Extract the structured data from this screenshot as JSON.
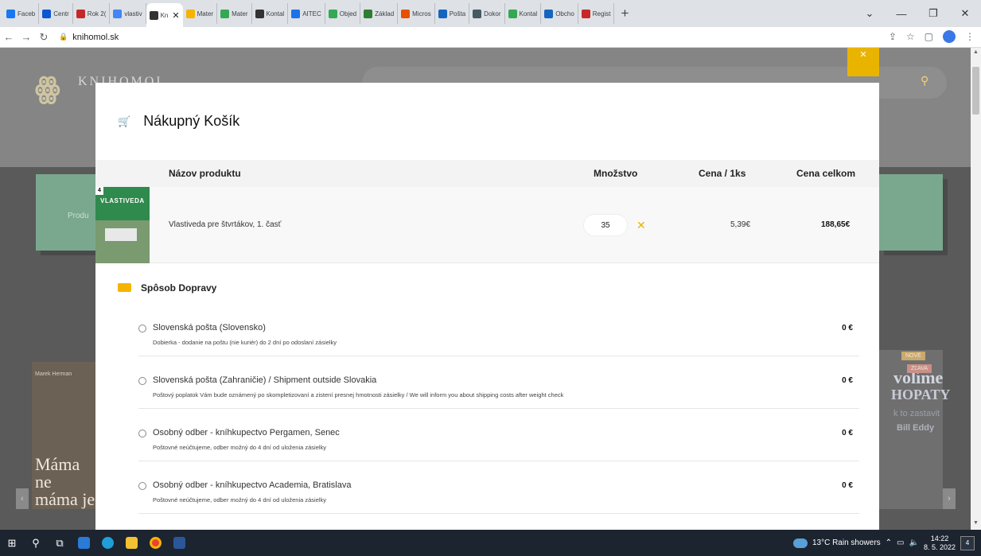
{
  "browser": {
    "tabs": [
      {
        "label": "Faceb",
        "color": "#1877f2"
      },
      {
        "label": "Centr",
        "color": "#0b57d0"
      },
      {
        "label": "Rok 2(",
        "color": "#c62828"
      },
      {
        "label": "vlastiv",
        "color": "#4285f4"
      },
      {
        "label": "Kn",
        "color": "#333333",
        "active": true
      },
      {
        "label": "Mater",
        "color": "#f4b400"
      },
      {
        "label": "Mater",
        "color": "#34a853"
      },
      {
        "label": "Kontal",
        "color": "#333333"
      },
      {
        "label": "AITEC",
        "color": "#1a73e8"
      },
      {
        "label": "Objed",
        "color": "#34a853"
      },
      {
        "label": "Základ",
        "color": "#2e7d32"
      },
      {
        "label": "Micros",
        "color": "#e65100"
      },
      {
        "label": "Pošta",
        "color": "#1565c0"
      },
      {
        "label": "Dokor",
        "color": "#455a64"
      },
      {
        "label": "Kontal",
        "color": "#34a853"
      },
      {
        "label": "Obcho",
        "color": "#1565c0"
      },
      {
        "label": "Regist",
        "color": "#c62828"
      }
    ],
    "url": "knihomol.sk"
  },
  "site": {
    "brand_name": "KNIHOMOL",
    "badge_new": "NOVÉ",
    "badge_sale": "ZĽAVA",
    "left_card": "Produ",
    "left_book": {
      "author": "Marek Herman",
      "title": "Máma ne máma je"
    },
    "right_book": {
      "line1": "volíme",
      "line2": "HOPATY",
      "line3": "k to zastavit",
      "line4": "Bill Eddy"
    }
  },
  "cart": {
    "title": "Nákupný Košík",
    "columns": {
      "name": "Názov produktu",
      "qty": "Množstvo",
      "unit": "Cena / 1ks",
      "total": "Cena celkom"
    },
    "product": {
      "cover_grade": "4",
      "cover_title": "VLASTIVEDA",
      "name": "Vlastiveda pre štvrtákov, 1. časť",
      "quantity": "35",
      "unit_price": "5,39€",
      "total_price": "188,65€"
    }
  },
  "shipping": {
    "title": "Spôsob Dopravy",
    "options": [
      {
        "name": "Slovenská pošta (Slovensko)",
        "desc": "Dobierka - dodanie na poštu (nie kuriér) do 2 dní po odoslaní zásielky",
        "price": "0 €"
      },
      {
        "name": "Slovenská pošta (Zahraničie) / Shipment outside Slovakia",
        "desc": "Poštový poplatok Vám bude oznámený po skompletizovaní a zistení presnej hmotnosti zásielky / We will inform you about shipping costs after weight check",
        "price": "0 €"
      },
      {
        "name": "Osobný odber - kníhkupectvo Pergamen, Senec",
        "desc": "Poštovné neúčtujeme, odber možný do 4 dní od uloženia zásielky",
        "price": "0 €"
      },
      {
        "name": "Osobný odber - kníhkupectvo Academia, Bratislava",
        "desc": "Poštovné neúčtujeme, odber možný do 4 dní od uloženia zásielky",
        "price": "0 €"
      }
    ]
  },
  "taskbar": {
    "weather": "13°C  Rain showers",
    "time": "14:22",
    "date": "8. 5. 2022",
    "notifications": "4"
  }
}
